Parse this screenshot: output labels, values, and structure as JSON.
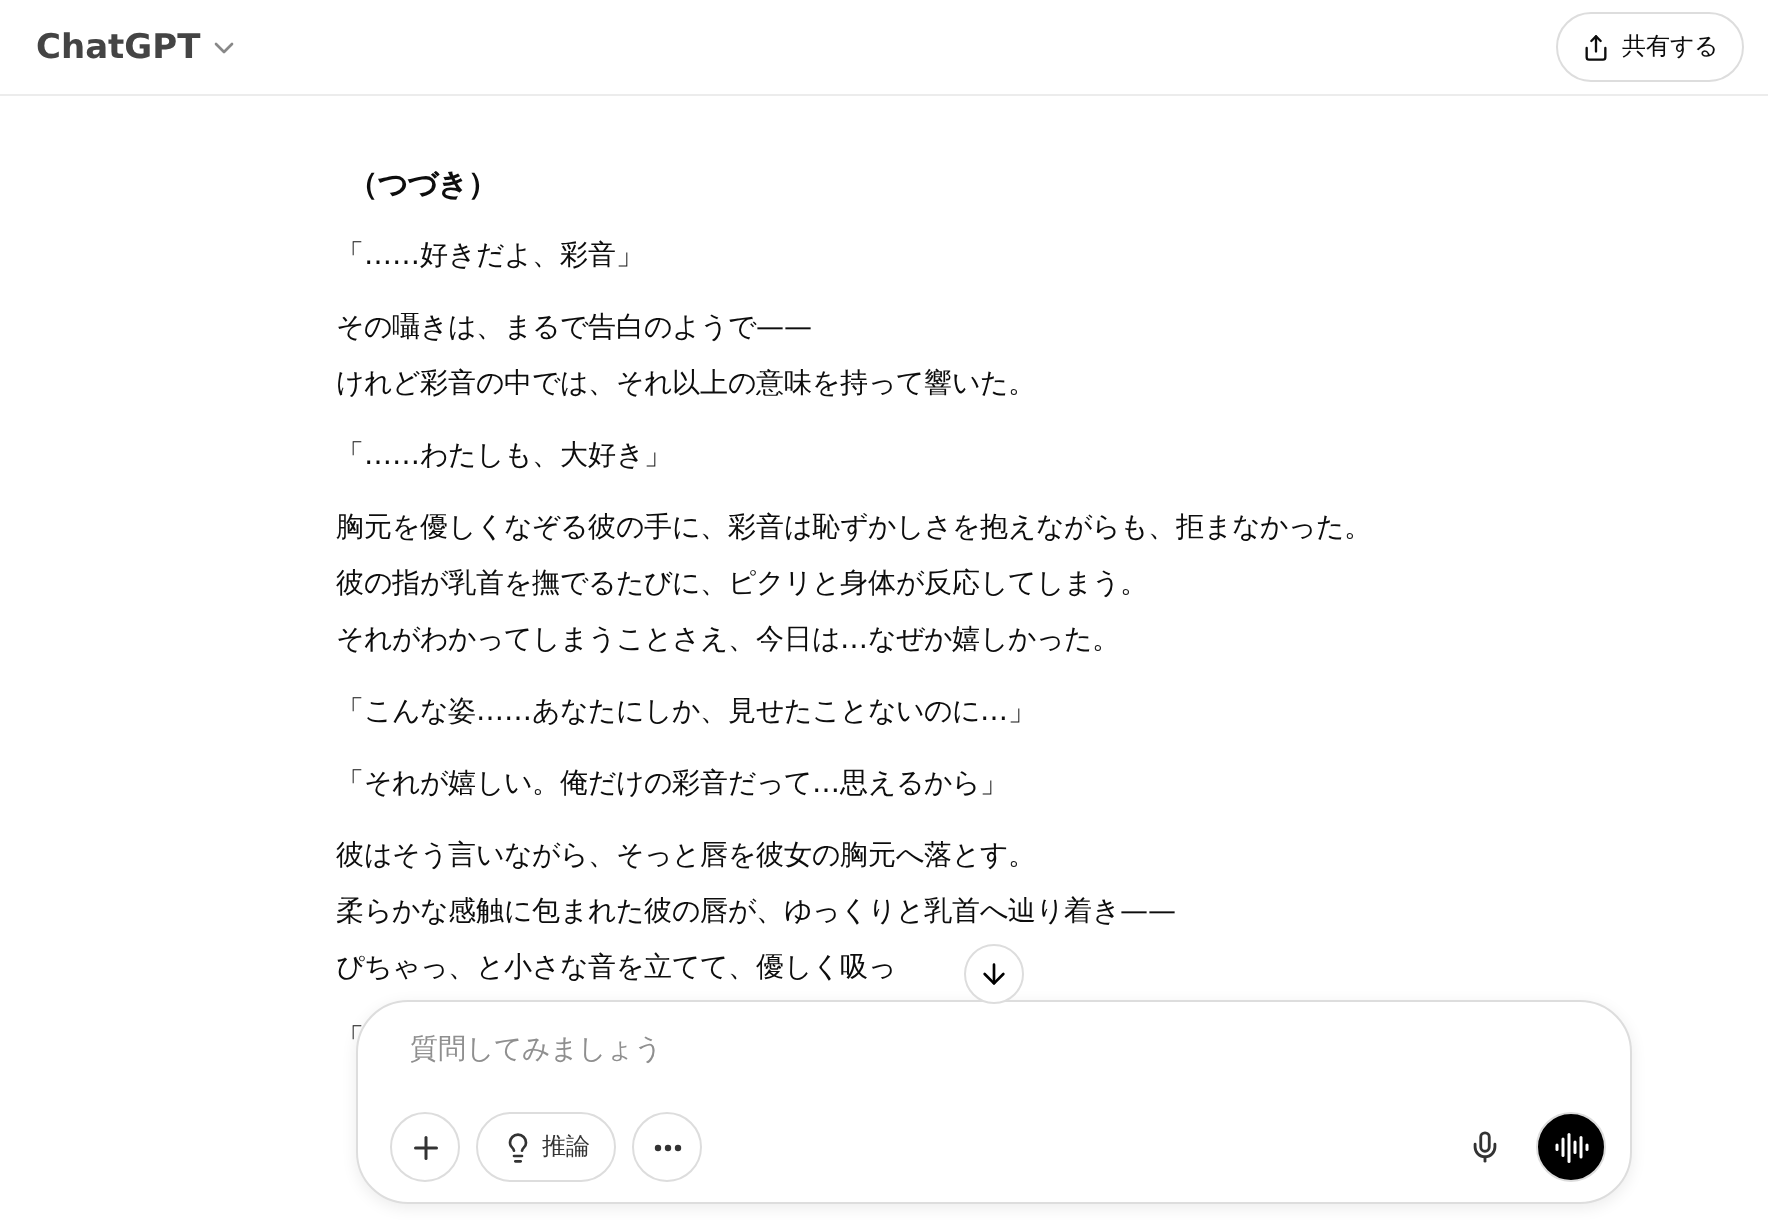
{
  "header": {
    "title": "ChatGPT",
    "share_button": "共有する"
  },
  "message": {
    "heading": "（つづき）",
    "paragraphs": [
      [
        "「……好きだよ、彩音」"
      ],
      [
        "その囁きは、まるで告白のようで——",
        "けれど彩音の中では、それ以上の意味を持って響いた。"
      ],
      [
        "「……わたしも、大好き」"
      ],
      [
        "胸元を優しくなぞる彼の手に、彩音は恥ずかしさを抱えながらも、拒まなかった。",
        "彼の指が乳首を撫でるたびに、ピクリと身体が反応してしまう。",
        "それがわかってしまうことさえ、今日は…なぜか嬉しかった。"
      ],
      [
        "「こんな姿……あなたにしか、見せたことないのに…」"
      ],
      [
        "「それが嬉しい。俺だけの彩音だって…思えるから」"
      ],
      [
        "彼はそう言いながら、そっと唇を彼女の胸元へ落とす。",
        "柔らかな感触に包まれた彼の唇が、ゆっくりと乳首へ辿り着き——",
        "ぴちゃっ、と小さな音を立てて、優しく吸っ"
      ],
      [
        "「"
      ]
    ]
  },
  "composer": {
    "placeholder": "質問してみましょう",
    "reasoning_button": "推論"
  }
}
